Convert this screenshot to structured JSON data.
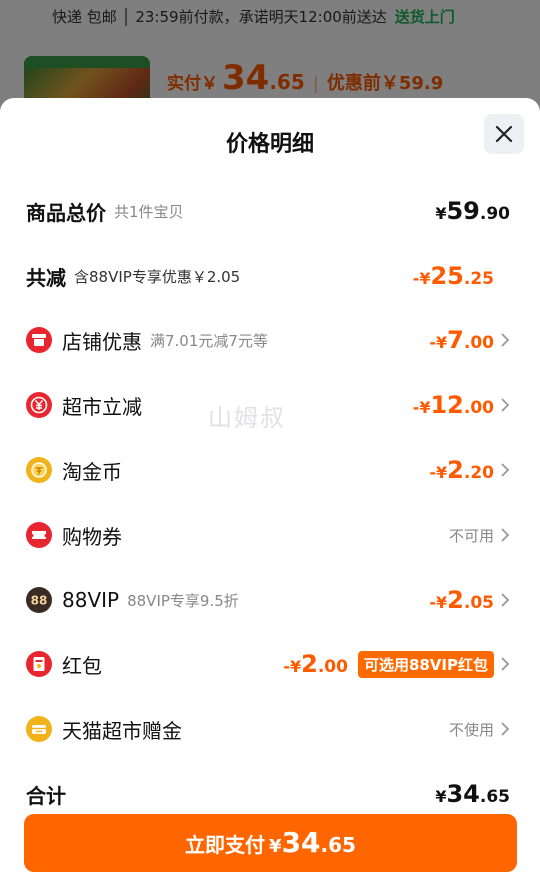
{
  "background": {
    "shipping_line": "快递 包邮 │ 23:59前付款，承诺明天12:00前送达",
    "delivery_tag": "送货上门",
    "paid_label": "实付￥",
    "paid_int": "34",
    "paid_dec": ".65",
    "before_discount": "优惠前￥59.9"
  },
  "sheet": {
    "title": "价格明细",
    "close_icon": "close-icon",
    "total": {
      "label": "商品总价",
      "sub": "共1件宝贝",
      "currency": "¥",
      "int": "59",
      "dec": ".90"
    },
    "discount_total": {
      "label": "共减",
      "sub": "含88VIP专享优惠￥2.05",
      "currency": "-¥",
      "int": "25",
      "dec": ".25"
    },
    "items": [
      {
        "label": "店铺优惠",
        "sub": "满7.01元减7元等",
        "icon": "shop-icon",
        "currency": "-¥",
        "int": "7",
        "dec": ".00"
      },
      {
        "label": "超市立减",
        "sub": "",
        "icon": "yuan-icon",
        "currency": "-¥",
        "int": "12",
        "dec": ".00"
      },
      {
        "label": "淘金币",
        "sub": "",
        "icon": "coin-icon",
        "currency": "-¥",
        "int": "2",
        "dec": ".20"
      },
      {
        "label": "购物券",
        "sub": "",
        "icon": "ticket-icon",
        "status": "不可用"
      },
      {
        "label": "88VIP",
        "sub": "88VIP专享9.5折",
        "icon": "vip-88-icon",
        "currency": "-¥",
        "int": "2",
        "dec": ".05"
      },
      {
        "label": "红包",
        "sub": "",
        "icon": "red-packet-icon",
        "currency": "-¥",
        "int": "2",
        "dec": ".00",
        "badge": "可选用88VIP红包"
      },
      {
        "label": "天猫超市赠金",
        "sub": "",
        "icon": "gift-money-icon",
        "status": "不使用"
      }
    ],
    "sum": {
      "label": "合计",
      "currency": "¥",
      "int": "34",
      "dec": ".65"
    },
    "watermark": "山姆叔",
    "pay_button": {
      "label": "立即支付",
      "currency": "¥",
      "int": "34",
      "dec": ".65"
    }
  },
  "colors": {
    "accent": "#ff5a00",
    "pay_button": "#ff6600",
    "icon_red": "#e8262f",
    "icon_gold": "#f2b21a",
    "icon_dark": "#3a2c24"
  }
}
